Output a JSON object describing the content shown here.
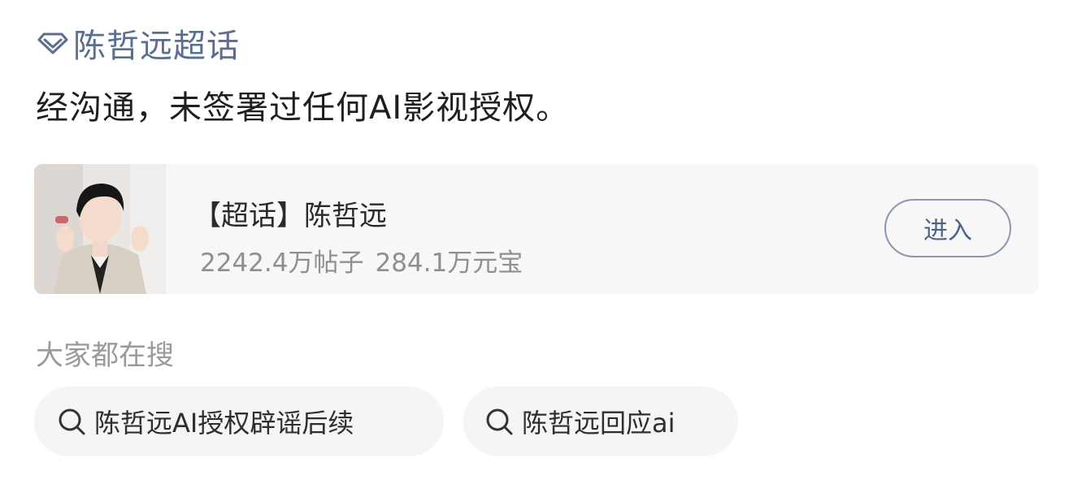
{
  "topic": {
    "name": "陈哲远超话",
    "icon": "diamond-icon"
  },
  "post": {
    "text": "经沟通，未签署过任何AI影视授权。"
  },
  "card": {
    "title": "【超话】陈哲远",
    "posts": "2242.4万帖子",
    "coins": "284.1万元宝",
    "button_label": "进入"
  },
  "related": {
    "title": "大家都在搜",
    "items": [
      {
        "label": "陈哲远AI授权辟谣后续",
        "icon": "search-icon"
      },
      {
        "label": "陈哲远回应ai",
        "icon": "search-icon"
      }
    ]
  },
  "colors": {
    "link": "#5a6f8f",
    "button_border": "#8c97ad",
    "card_bg": "#f7f7f7",
    "chip_bg": "#f5f5f5"
  }
}
